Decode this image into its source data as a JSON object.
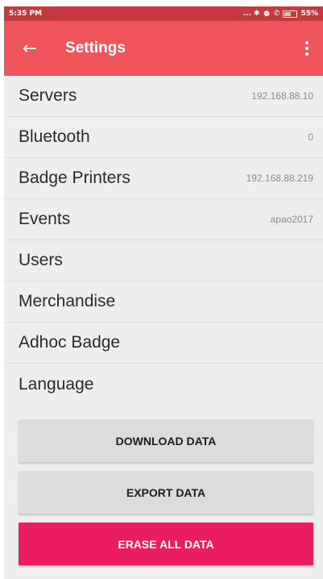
{
  "status_bar": {
    "time": "5:35 PM",
    "icons": [
      "dots-icon",
      "bluetooth-icon",
      "alarm-icon",
      "wifi-icon",
      "sim-icon",
      "charging-icon",
      "battery-icon"
    ],
    "signal_glyphs": "... ✱ ⏰ ✆",
    "battery_percent": "55%"
  },
  "app_bar": {
    "back_glyph": "←",
    "title": "Settings"
  },
  "settings": {
    "items": [
      {
        "label": "Servers",
        "value": "192.168.88.10"
      },
      {
        "label": "Bluetooth",
        "value": "0"
      },
      {
        "label": "Badge Printers",
        "value": "192.168.88.219"
      },
      {
        "label": "Events",
        "value": "apao2017"
      },
      {
        "label": "Users",
        "value": ""
      },
      {
        "label": "Merchandise",
        "value": ""
      },
      {
        "label": "Adhoc Badge",
        "value": ""
      },
      {
        "label": "Language",
        "value": ""
      }
    ]
  },
  "actions": {
    "download": "DOWNLOAD DATA",
    "export": "EXPORT DATA",
    "erase": "ERASE ALL DATA"
  },
  "colors": {
    "status_bar": "#c53a3f",
    "app_bar": "#f0555c",
    "background": "#eeeeee",
    "erase_button": "#ea1d62",
    "neutral_button": "#dcdcdc"
  }
}
